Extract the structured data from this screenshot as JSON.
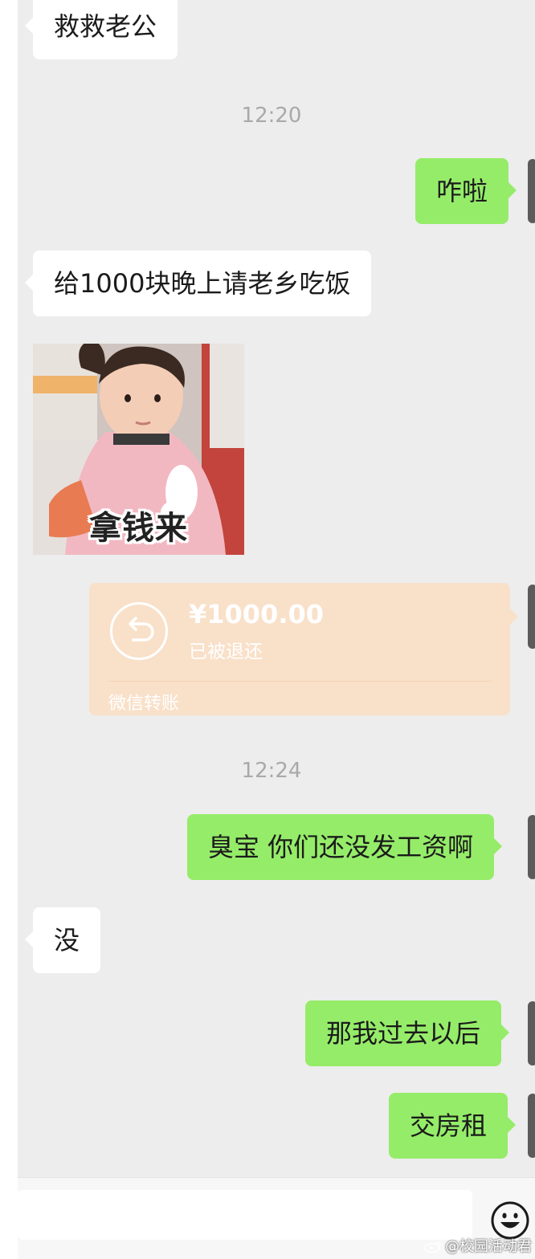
{
  "chat": {
    "messages": [
      {
        "type": "text",
        "side": "in",
        "text": "救救老公"
      },
      {
        "type": "time",
        "text": "12:20"
      },
      {
        "type": "text",
        "side": "out",
        "text": "咋啦"
      },
      {
        "type": "text",
        "side": "in",
        "text": "给1000块晚上请老乡吃饭"
      },
      {
        "type": "sticker",
        "side": "in",
        "caption": "拿钱来"
      },
      {
        "type": "transfer",
        "side": "out",
        "amount": "¥1000.00",
        "status": "已被退还",
        "label": "微信转账"
      },
      {
        "type": "time",
        "text": "12:24"
      },
      {
        "type": "text",
        "side": "out",
        "text": "臭宝 你们还没发工资啊"
      },
      {
        "type": "text",
        "side": "in",
        "text": "没"
      },
      {
        "type": "text",
        "side": "out",
        "text": "那我过去以后"
      },
      {
        "type": "text",
        "side": "out",
        "text": "交房租"
      }
    ]
  },
  "input_bar": {
    "emoji_icon": "smiley-face-icon"
  },
  "watermark": {
    "icon": "weibo-logo",
    "text": "@校园活动君"
  },
  "colors": {
    "chat_background": "#ededed",
    "outgoing_bubble": "#95ec69",
    "incoming_bubble": "#ffffff",
    "transfer_card": "#f9e0c9",
    "timestamp": "#a9a9a9"
  }
}
